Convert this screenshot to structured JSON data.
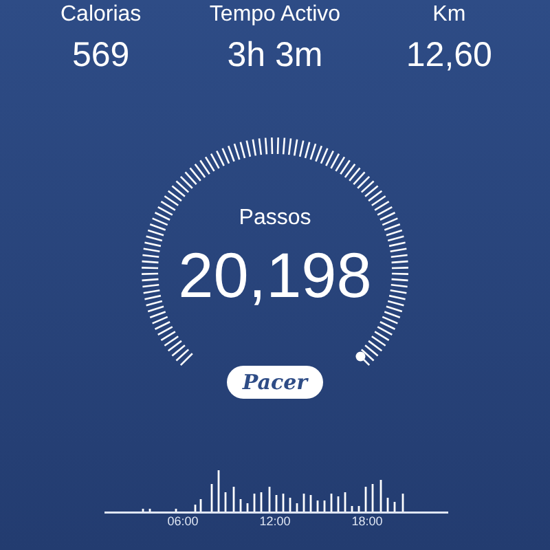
{
  "stats": [
    {
      "label": "Calorias",
      "value": "569"
    },
    {
      "label": "Tempo Activo",
      "value": "3h 3m"
    },
    {
      "label": "Km",
      "value": "12,60"
    }
  ],
  "steps": {
    "label": "Passos",
    "value": "20,198"
  },
  "logo": {
    "text": "Pacer"
  },
  "activity_chart": {
    "time_labels": [
      "06:00",
      "12:00",
      "18:00"
    ]
  }
}
